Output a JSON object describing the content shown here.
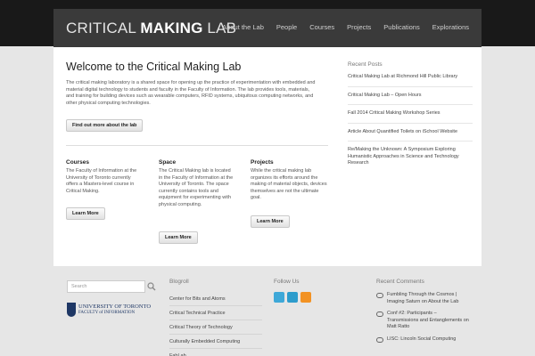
{
  "header": {
    "logo_prefix": "CRITICAL ",
    "logo_bold": "MAKING",
    "logo_suffix": " LAB",
    "nav": [
      "About the Lab",
      "People",
      "Courses",
      "Projects",
      "Publications",
      "Explorations"
    ]
  },
  "main": {
    "title": "Welcome to the Critical Making Lab",
    "intro": "The critical making laboratory is a shared space for opening up the practice of experimentation with embedded and material digital technology to students and faculty in the Faculty of Information. The lab provides tools, materials, and training for building devices such as wearable computers, RFID systems, ubiquitous computing networks, and other physical computing technologies.",
    "about_button": "Find out more about the lab",
    "columns": [
      {
        "title": "Courses",
        "text": "The Faculty of Information at the University of Toronto currently offers a Masters-level course in Critical Making.",
        "button": "Learn More"
      },
      {
        "title": "Space",
        "text": "The Critical Making lab is located in the Faculty of Information at the University of Toronto. The space currently contains tools and equipment for experimenting with physical computing.",
        "button": "Learn More"
      },
      {
        "title": "Projects",
        "text": "While the critical making lab organizes its efforts around the making of material objects, devices themselves are not the ultimate goal.",
        "button": "Learn More"
      }
    ]
  },
  "sidebar": {
    "title": "Recent Posts",
    "posts": [
      "Critical Making Lab at Richmond Hill Public Library",
      "Critical Making Lab – Open Hours",
      "Fall 2014 Critical Making Workshop Series",
      "Article About Quantified Toilets on iSchool Website",
      "Re/Making the Unknown: A Symposium Exploring Humanistic Approaches in Science and Technology Research"
    ]
  },
  "footer": {
    "search_placeholder": "Search",
    "uoft_line1": "UNIVERSITY OF TORONTO",
    "uoft_line2": "FACULTY of INFORMATION",
    "blogroll_title": "Blogroll",
    "blogroll": [
      "Center for Bits and Atoms",
      "Critical Technical Practice",
      "Critical Theory of Technology",
      "Culturally Embedded Computing",
      "FabLab"
    ],
    "follow_title": "Follow Us",
    "social_icons": [
      "twitter-icon",
      "vimeo-icon",
      "rss-icon"
    ],
    "comments_title": "Recent Comments",
    "comments": [
      "Fumbling Through the Cosmos | Imaging Saturn on About the Lab",
      "Conf #2: Participants – Transmissions and Entanglements on Matt Ratto",
      "LISC: Lincoln Social Computing"
    ]
  },
  "colors": {
    "top_bar": "#191919",
    "header": "#3a3a3a",
    "footer": "#e6e6e6",
    "twitter": "#3ea8d8",
    "vimeo": "#2d9ccc",
    "rss": "#f29223"
  }
}
